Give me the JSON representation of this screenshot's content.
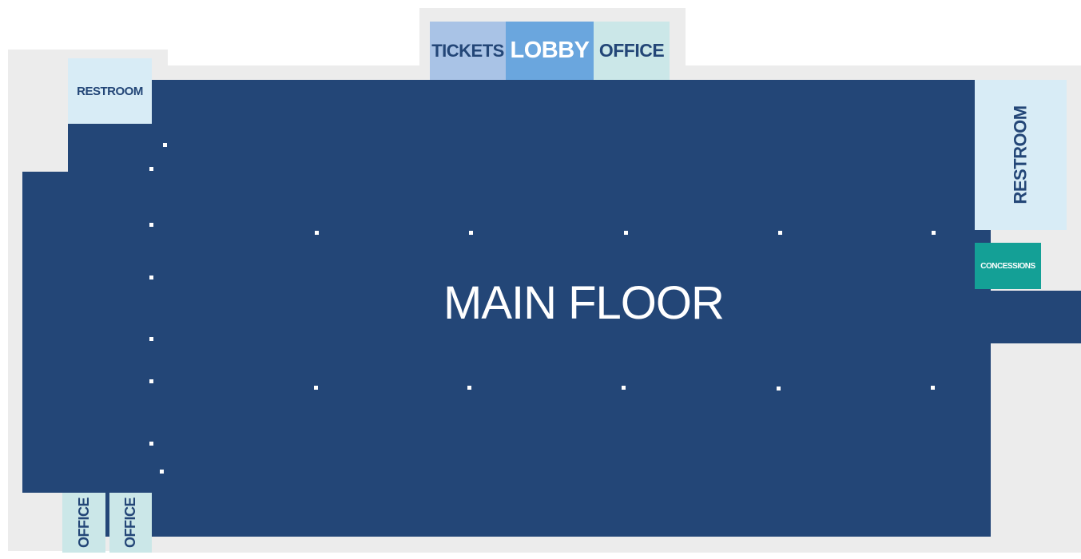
{
  "map": {
    "main_floor_label": "MAIN FLOOR",
    "colors": {
      "floor": "#234677",
      "outline": "#ececec",
      "restroom": "#d8ecf6",
      "tickets": "#a9c3e6",
      "lobby": "#6aa6de",
      "office": "#cbe7e8",
      "concessions": "#14a096"
    },
    "rooms": {
      "tickets": "TICKETS",
      "lobby": "LOBBY",
      "office_top": "OFFICE",
      "restroom_left": "RESTROOM",
      "restroom_right": "RESTROOM",
      "concessions": "CONCESSIONS",
      "office_bottom_1": "OFFICE",
      "office_bottom_2": "OFFICE"
    }
  }
}
